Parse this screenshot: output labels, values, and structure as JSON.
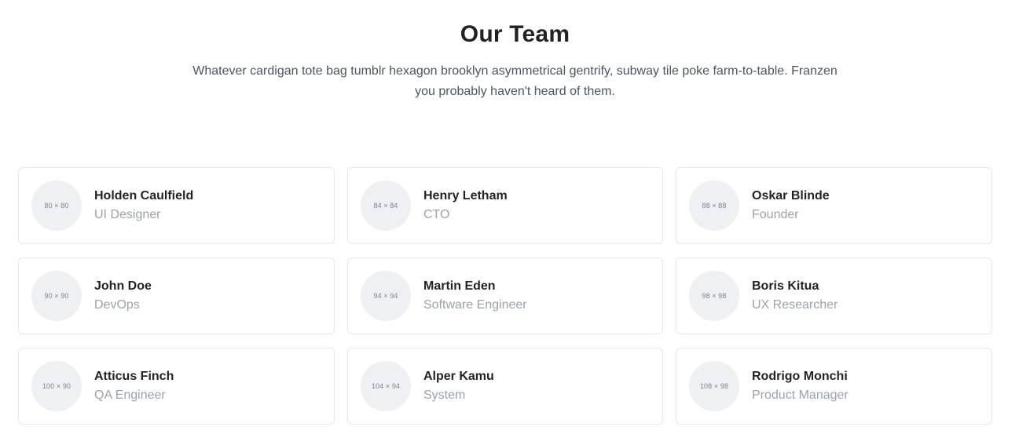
{
  "header": {
    "title": "Our Team",
    "subtitle": "Whatever cardigan tote bag tumblr hexagon brooklyn asymmetrical gentrify, subway tile poke farm-to-table. Franzen you probably haven't heard of them."
  },
  "team": [
    {
      "name": "Holden Caulfield",
      "role": "UI Designer",
      "avatar_label": "80 × 80"
    },
    {
      "name": "Henry Letham",
      "role": "CTO",
      "avatar_label": "84 × 84"
    },
    {
      "name": "Oskar Blinde",
      "role": "Founder",
      "avatar_label": "88 × 88"
    },
    {
      "name": "John Doe",
      "role": "DevOps",
      "avatar_label": "90 × 90"
    },
    {
      "name": "Martin Eden",
      "role": "Software Engineer",
      "avatar_label": "94 × 94"
    },
    {
      "name": "Boris Kitua",
      "role": "UX Researcher",
      "avatar_label": "98 × 98"
    },
    {
      "name": "Atticus Finch",
      "role": "QA Engineer",
      "avatar_label": "100 × 90"
    },
    {
      "name": "Alper Kamu",
      "role": "System",
      "avatar_label": "104 × 94"
    },
    {
      "name": "Rodrigo Monchi",
      "role": "Product Manager",
      "avatar_label": "108 × 98"
    }
  ],
  "colors": {
    "card_border": "#e6e8eb",
    "avatar_bg": "#eff0f4",
    "role_text": "#9aa2ad",
    "heading_text": "#1f2328"
  }
}
